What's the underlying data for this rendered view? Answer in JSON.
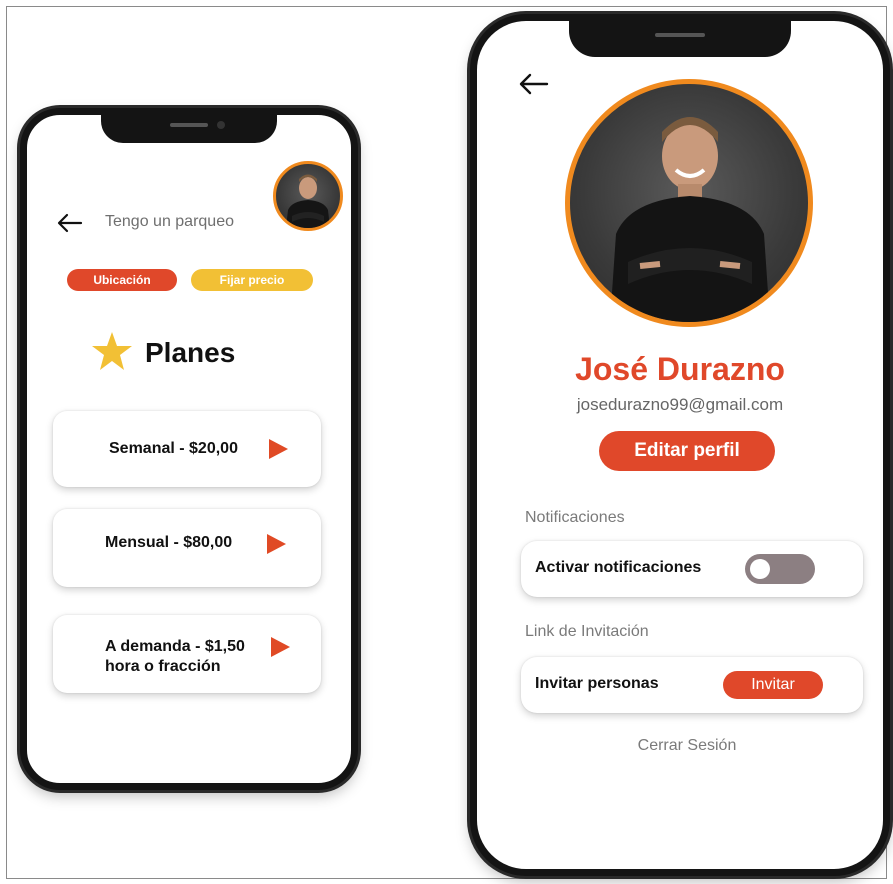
{
  "left_screen": {
    "title": "Tengo un parqueo",
    "tabs": [
      {
        "label": "Ubicación",
        "color": "#e0482a"
      },
      {
        "label": "Fijar precio",
        "color": "#f2c035"
      }
    ],
    "section_title": "Planes",
    "plans": [
      {
        "line1": "Semanal - $20,00",
        "line2": ""
      },
      {
        "line1": "Mensual - $80,00",
        "line2": ""
      },
      {
        "line1": "A demanda - $1,50",
        "line2": "hora o fracción"
      }
    ],
    "icons": {
      "back": "back-arrow-icon",
      "star": "star-icon",
      "play": "play-icon",
      "avatar": "avatar"
    }
  },
  "right_screen": {
    "name": "José Durazno",
    "email": "josedurazno99@gmail.com",
    "edit_button": "Editar perfil",
    "notifications_section": "Notificaciones",
    "notifications_toggle_label": "Activar notificaciones",
    "notifications_enabled": false,
    "invite_section": "Link de Invitación",
    "invite_label": "Invitar personas",
    "invite_button": "Invitar",
    "logout": "Cerrar Sesión"
  },
  "colors": {
    "accent_red": "#e0482a",
    "accent_yellow": "#f2c035",
    "avatar_ring": "#f08a1e",
    "toggle_off": "#8c7f82"
  }
}
